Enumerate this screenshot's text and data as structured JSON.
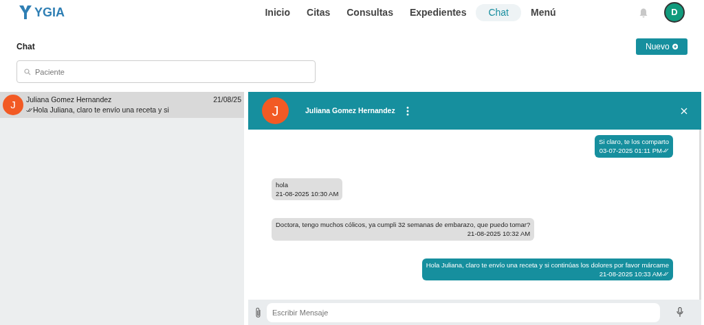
{
  "brand": {
    "name": "YGIA"
  },
  "nav": [
    {
      "label": "Inicio",
      "selected": false
    },
    {
      "label": "Citas",
      "selected": false
    },
    {
      "label": "Consultas",
      "selected": false
    },
    {
      "label": "Expedientes",
      "selected": false
    },
    {
      "label": "Chat",
      "selected": true
    },
    {
      "label": "Menú",
      "selected": false
    }
  ],
  "user": {
    "initial": "D"
  },
  "page": {
    "title": "Chat",
    "new_button": "Nuevo"
  },
  "search": {
    "placeholder": "Paciente"
  },
  "conversations": [
    {
      "initial": "J",
      "name": "Juliana Gomez Hernandez",
      "date": "21/08/25",
      "preview": "Hola Juliana, claro te envío una receta y si",
      "selected": true
    }
  ],
  "chat": {
    "initial": "J",
    "name": "Juliana Gomez Hernandez",
    "messages": [
      {
        "kind": "outgoing",
        "text": "Si claro, te los comparto",
        "time": "03-07-2025 01:11 PM"
      },
      {
        "kind": "incoming",
        "text": "hola",
        "time": "21-08-2025 10:30 AM"
      },
      {
        "kind": "incoming",
        "text": "Doctora, tengo muchos cólicos, ya cumpli 32 semanas de embarazo, que puedo tomar?",
        "time": "21-08-2025 10:32 AM"
      },
      {
        "kind": "outgoing",
        "text": "Hola Juliana, claro te envío una receta y si continúas los dolores por favor márcame",
        "time": "21-08-2025 10:33 AM"
      }
    ],
    "input_placeholder": "Escribir Mensaje"
  }
}
